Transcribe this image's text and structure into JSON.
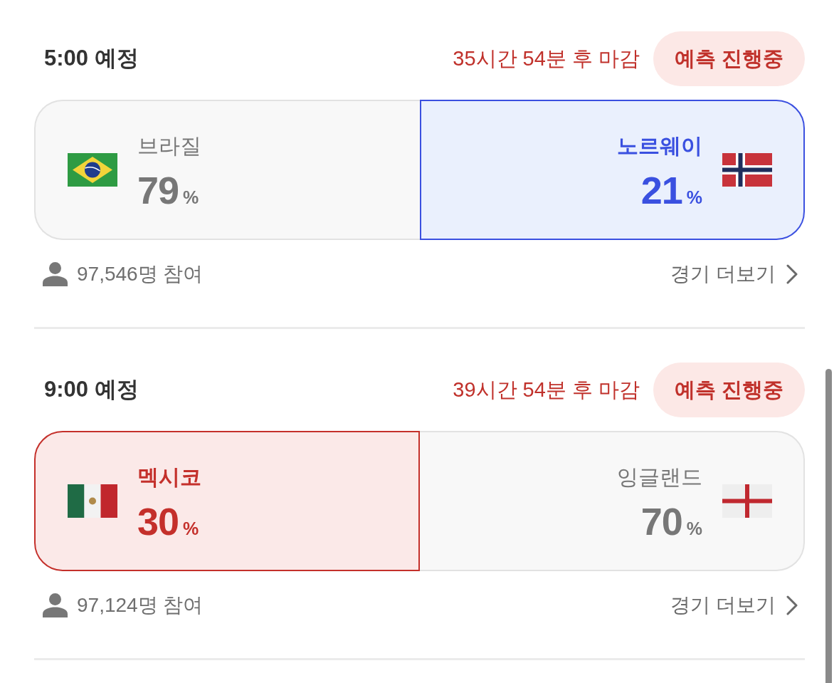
{
  "matches": [
    {
      "time": "5:00 예정",
      "deadline": "35시간 54분 후 마감",
      "status": "예측 진행중",
      "teams": [
        {
          "name": "브라질",
          "kind": "brazil",
          "percent": "79",
          "unit": "%",
          "selected": false
        },
        {
          "name": "노르웨이",
          "kind": "norway",
          "percent": "21",
          "unit": "%",
          "selected": true
        }
      ],
      "participants": "97,546명 참여",
      "more_link": "경기 더보기"
    },
    {
      "time": "9:00 예정",
      "deadline": "39시간 54분 후 마감",
      "status": "예측 진행중",
      "teams": [
        {
          "name": "멕시코",
          "kind": "mexico",
          "percent": "30",
          "unit": "%",
          "selected": true
        },
        {
          "name": "잉글랜드",
          "kind": "england",
          "percent": "70",
          "unit": "%",
          "selected": false
        }
      ],
      "participants": "97,124명 참여",
      "more_link": "경기 더보기"
    }
  ]
}
